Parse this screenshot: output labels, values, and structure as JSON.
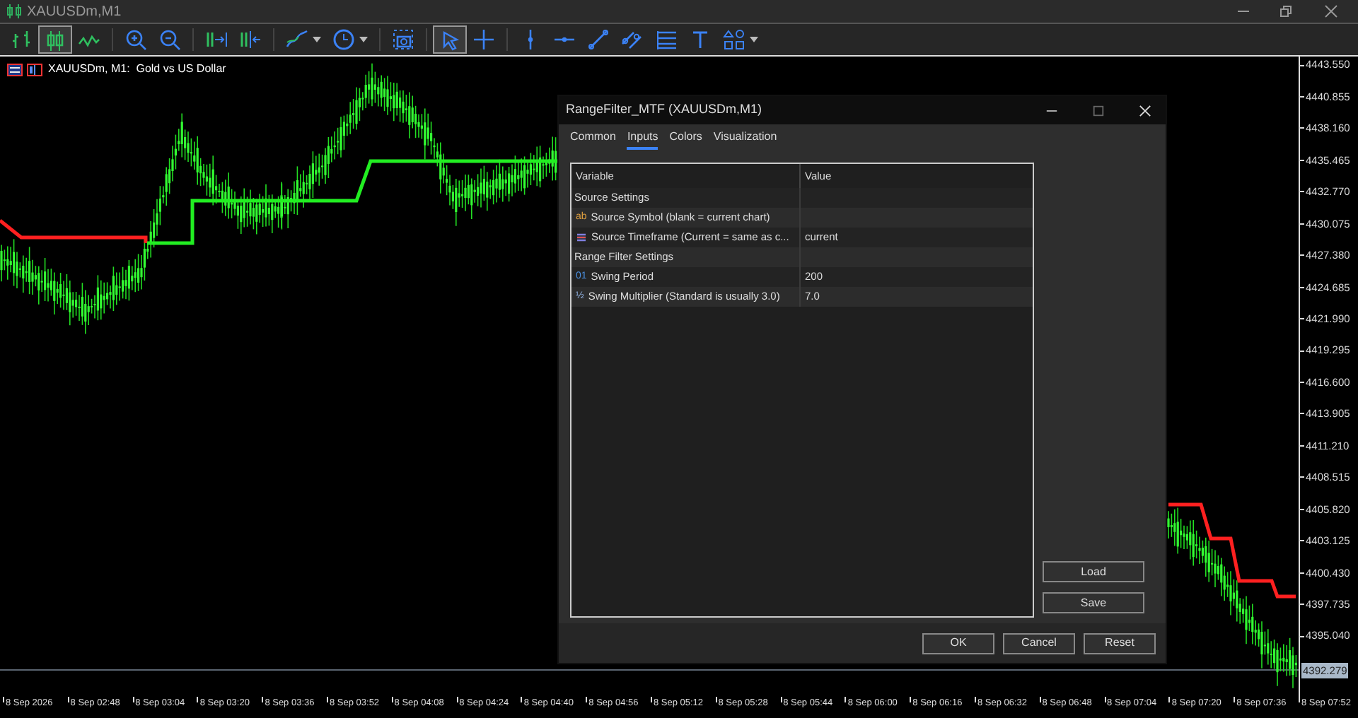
{
  "window": {
    "title": "XAUUSDm,M1"
  },
  "toolbar": [
    {
      "kind": "bars",
      "selected": false
    },
    {
      "kind": "candles",
      "selected": true
    },
    {
      "kind": "line",
      "selected": false
    },
    {
      "kind": "sep"
    },
    {
      "kind": "zoom-in",
      "selected": false
    },
    {
      "kind": "zoom-out",
      "selected": false
    },
    {
      "kind": "sep"
    },
    {
      "kind": "scroll",
      "selected": false
    },
    {
      "kind": "shift",
      "selected": false
    },
    {
      "kind": "sep"
    },
    {
      "kind": "indicators",
      "selected": false
    },
    {
      "kind": "clock",
      "selected": false
    },
    {
      "kind": "sep"
    },
    {
      "kind": "camera",
      "selected": false
    },
    {
      "kind": "sep"
    },
    {
      "kind": "cursor",
      "selected": true
    },
    {
      "kind": "crosshair",
      "selected": false
    },
    {
      "kind": "sep"
    },
    {
      "kind": "vline",
      "selected": false
    },
    {
      "kind": "hline",
      "selected": false
    },
    {
      "kind": "trendline",
      "selected": false
    },
    {
      "kind": "channel",
      "selected": false
    },
    {
      "kind": "fibo",
      "selected": false
    },
    {
      "kind": "text",
      "selected": false
    },
    {
      "kind": "shapes",
      "selected": false
    }
  ],
  "chart": {
    "legend": "XAUUSDm, M1:  Gold vs US Dollar",
    "price_axis": [
      "4443.550",
      "4440.855",
      "4438.160",
      "4435.465",
      "4432.770",
      "4430.075",
      "4427.380",
      "4424.685",
      "4421.990",
      "4419.295",
      "4416.600",
      "4413.905",
      "4411.210",
      "4408.515",
      "4405.820",
      "4403.125",
      "4400.430",
      "4397.735",
      "4395.040"
    ],
    "current_price": "4392.279",
    "time_axis": [
      "8 Sep 2026",
      "8 Sep 02:48",
      "8 Sep 03:04",
      "8 Sep 03:20",
      "8 Sep 03:36",
      "8 Sep 03:52",
      "8 Sep 04:08",
      "8 Sep 04:24",
      "8 Sep 04:40",
      "8 Sep 04:56",
      "8 Sep 05:12",
      "8 Sep 05:28",
      "8 Sep 05:44",
      "8 Sep 06:00",
      "8 Sep 06:16",
      "8 Sep 06:32",
      "8 Sep 06:48",
      "8 Sep 07:04",
      "8 Sep 07:20",
      "8 Sep 07:36",
      "8 Sep 07:52"
    ]
  },
  "dialog": {
    "title": "RangeFilter_MTF (XAUUSDm,M1)",
    "tabs": [
      {
        "label": "Common",
        "selected": false
      },
      {
        "label": "Inputs",
        "selected": true
      },
      {
        "label": "Colors",
        "selected": false
      },
      {
        "label": "Visualization",
        "selected": false
      }
    ],
    "columns": [
      "Variable",
      "Value"
    ],
    "rows": [
      {
        "kind": "group",
        "label": "Source Settings"
      },
      {
        "kind": "string",
        "icon": "ab",
        "label": "Source Symbol (blank = current chart)"
      },
      {
        "kind": "enum",
        "label": "Source Timeframe (Current = same as c...",
        "value": "current"
      },
      {
        "kind": "group",
        "label": "Range Filter Settings"
      },
      {
        "kind": "int",
        "icon": "01",
        "label": "Swing Period",
        "value": "200"
      },
      {
        "kind": "double",
        "icon": "½",
        "label": "Swing Multiplier (Standard is usually 3.0)",
        "value": "7.0"
      }
    ],
    "side_buttons": [
      "Load",
      "Save"
    ],
    "buttons": [
      "OK",
      "Cancel",
      "Reset"
    ]
  }
}
